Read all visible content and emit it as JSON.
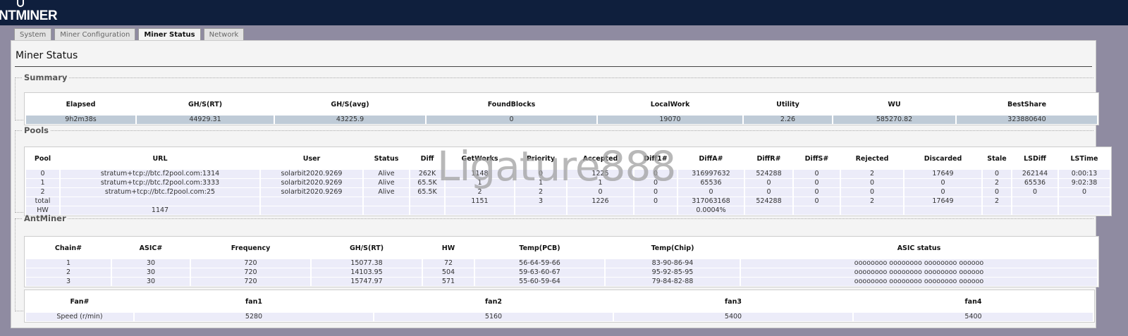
{
  "header": {
    "logo": "NTMINER"
  },
  "tabs": [
    "System",
    "Miner Configuration",
    "Miner Status",
    "Network"
  ],
  "active_tab": 2,
  "page_title": "Miner Status",
  "summary": {
    "legend": "Summary",
    "headers": [
      "Elapsed",
      "GH/S(RT)",
      "GH/S(avg)",
      "FoundBlocks",
      "LocalWork",
      "Utility",
      "WU",
      "BestShare"
    ],
    "rows": [
      [
        "9h2m38s",
        "44929.31",
        "43225.9",
        "0",
        "19070",
        "2.26",
        "585270.82",
        "323880640"
      ]
    ]
  },
  "pools": {
    "legend": "Pools",
    "headers": [
      "Pool",
      "URL",
      "User",
      "Status",
      "Diff",
      "GetWorks",
      "Priority",
      "Accepted",
      "Diff1#",
      "DiffA#",
      "DiffR#",
      "DiffS#",
      "Rejected",
      "Discarded",
      "Stale",
      "LSDiff",
      "LSTime"
    ],
    "rows": [
      [
        "0",
        "stratum+tcp://btc.f2pool.com:1314",
        "solarbit2020.9269",
        "Alive",
        "262K",
        "1148",
        "0",
        "1225",
        "0",
        "316997632",
        "524288",
        "0",
        "2",
        "17649",
        "0",
        "262144",
        "0:00:13"
      ],
      [
        "1",
        "stratum+tcp://btc.f2pool.com:3333",
        "solarbit2020.9269",
        "Alive",
        "65.5K",
        "1",
        "1",
        "1",
        "0",
        "65536",
        "0",
        "0",
        "0",
        "0",
        "2",
        "65536",
        "9:02:38"
      ],
      [
        "2",
        "stratum+tcp://btc.f2pool.com:25",
        "solarbit2020.9269",
        "Alive",
        "65.5K",
        "2",
        "2",
        "0",
        "0",
        "0",
        "0",
        "0",
        "0",
        "0",
        "0",
        "0",
        "0"
      ],
      [
        "total",
        "",
        "",
        "",
        "",
        "1151",
        "3",
        "1226",
        "0",
        "317063168",
        "524288",
        "0",
        "2",
        "17649",
        "2",
        "",
        ""
      ],
      [
        "HW",
        "1147",
        "",
        "",
        "",
        "",
        "",
        "",
        "",
        "0.0004%",
        "",
        "",
        "",
        "",
        "",
        "",
        ""
      ]
    ]
  },
  "antminer": {
    "legend": "AntMiner",
    "headers": [
      "Chain#",
      "ASIC#",
      "Frequency",
      "GH/S(RT)",
      "HW",
      "Temp(PCB)",
      "Temp(Chip)",
      "ASIC status"
    ],
    "rows": [
      [
        "1",
        "30",
        "720",
        "15077.38",
        "72",
        "56-64-59-66",
        "83-90-86-94",
        "oooooooo oooooooo oooooooo oooooo"
      ],
      [
        "2",
        "30",
        "720",
        "14103.95",
        "504",
        "59-63-60-67",
        "95-92-85-95",
        "oooooooo oooooooo oooooooo oooooo"
      ],
      [
        "3",
        "30",
        "720",
        "15747.97",
        "571",
        "55-60-59-64",
        "79-84-82-88",
        "oooooooo oooooooo oooooooo oooooo"
      ]
    ]
  },
  "fans": {
    "headers": [
      "Fan#",
      "fan1",
      "fan2",
      "fan3",
      "fan4"
    ],
    "rows": [
      [
        "Speed (r/min)",
        "5280",
        "5160",
        "5400",
        "5400"
      ]
    ]
  },
  "watermark": "Ligature888"
}
